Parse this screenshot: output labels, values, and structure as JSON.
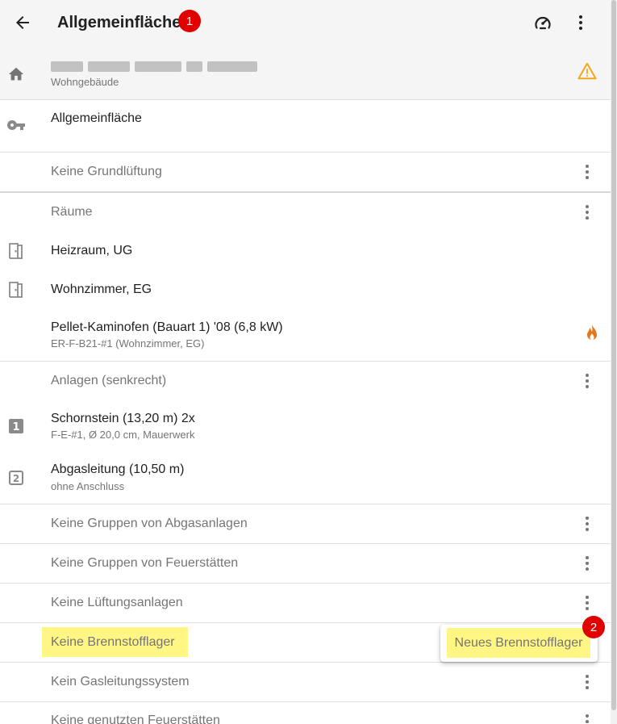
{
  "header": {
    "title": "Allgemeinfläche",
    "badge_1": "1",
    "icon_left": "back-arrow-icon",
    "icons_right": [
      "gauge-icon",
      "more-vert-icon"
    ]
  },
  "building": {
    "address": "",
    "type": "Wohngebäude",
    "warning_icon": "warning-icon",
    "warning_color": "#f0a81c"
  },
  "area": {
    "label": "Allgemeinfläche"
  },
  "ventilation": {
    "label": "Keine Grundlüftung"
  },
  "rooms": {
    "section_label": "Räume",
    "items": [
      {
        "label": "Heizraum, UG"
      },
      {
        "label": "Wohnzimmer, EG"
      }
    ]
  },
  "fireplace": {
    "title": "Pellet-Kaminofen (Bauart 1) '08 (6,8 kW)",
    "subtitle": "ER-F-B21-#1 (Wohnzimmer, EG)",
    "icon": "flame-icon",
    "icon_color": "#e6761a"
  },
  "systems": {
    "section_label": "Anlagen (senkrecht)",
    "items": [
      {
        "number": "1",
        "title": "Schornstein (13,20 m) 2x",
        "subtitle": "F-E-#1, Ø 20,0 cm, Mauerwerk"
      },
      {
        "number": "2",
        "title": "Abgasleitung (10,50 m)",
        "subtitle": "ohne Anschluss"
      }
    ]
  },
  "groups": {
    "exhaust_groups": "Keine Gruppen von Abgasanlagen",
    "fireplace_groups": "Keine Gruppen von Feuerstätten",
    "ventilation_systems": "Keine Lüftungsanlagen",
    "fuel_storage": "Keine Brennstofflager",
    "gas_line": "Kein Gasleitungssystem",
    "used_fireplaces": "Keine genutzten Feuerstätten"
  },
  "popup": {
    "item_label": "Neues Brennstofflager",
    "badge_2": "2"
  },
  "colors": {
    "highlight": "#fff683",
    "badge": "#e00000",
    "header_bg": "#f5f5f5"
  }
}
